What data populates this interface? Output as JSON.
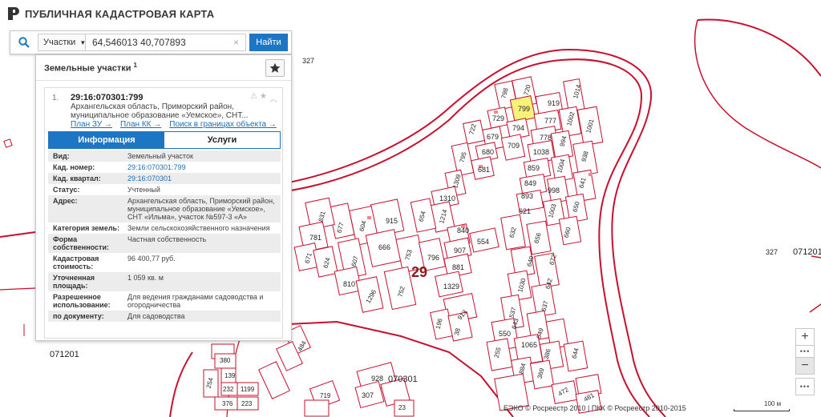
{
  "app": {
    "title": "ПУБЛИЧНАЯ КАДАСТРОВАЯ КАРТА"
  },
  "search": {
    "type_label": "Участки",
    "query": "64,546013 40,707893",
    "button_label": "Найти"
  },
  "panel": {
    "title": "Земельные участки",
    "count": "1",
    "item": {
      "number": "1.",
      "id": "29:16:070301:799",
      "address": "Архангельская область, Приморский район, муниципальное образование «Уемское», СНТ...",
      "links": [
        "План ЗУ →",
        "План КК →",
        "Поиск в границах объекта →"
      ]
    },
    "tabs": {
      "info": "Информация",
      "services": "Услуги"
    },
    "fields": [
      {
        "label": "Вид:",
        "value": "Земельный участок"
      },
      {
        "label": "Кад. номер:",
        "value": "29:16:070301:799",
        "link": true
      },
      {
        "label": "Кад. квартал:",
        "value": "29:16:070301",
        "link": true
      },
      {
        "label": "Статус:",
        "value": "Учтенный"
      },
      {
        "label": "Адрес:",
        "value": "Архангельская область, Приморский район, муниципальное образование «Уемское», СНТ «Ильма», участок №597-3 «А»"
      },
      {
        "label": "Категория земель:",
        "value": "Земли сельскохозяйственного назначения"
      },
      {
        "label": "Форма собственности:",
        "value": "Частная собственность"
      },
      {
        "label": "Кадастровая стоимость:",
        "value": "96 400,77 руб."
      },
      {
        "label": "Уточненная площадь:",
        "value": "1 059 кв. м"
      },
      {
        "label": "Разрешенное использование:",
        "value": "Для ведения гражданами садоводства и огородничества"
      },
      {
        "label": "по документу:",
        "value": "Для садоводства"
      }
    ]
  },
  "map": {
    "quarter_labels": [
      "327",
      "327",
      "071201",
      "071201",
      "070301"
    ],
    "block_label": "29",
    "selected_parcel": "799",
    "parcels": [
      "798",
      "720",
      "1014",
      "919",
      "777",
      "1002",
      "1001",
      "729",
      "794",
      "778",
      "994",
      "722",
      "679",
      "709",
      "1038",
      "938",
      "680",
      "795",
      "681",
      "859",
      "1004",
      "641",
      "1309",
      "849",
      "998",
      "1310",
      "893",
      "650",
      "621",
      "1003",
      "915",
      "654",
      "1214",
      "831",
      "604",
      "677",
      "840",
      "554",
      "632",
      "656",
      "660",
      "781",
      "666",
      "753",
      "907",
      "640",
      "624",
      "671",
      "607",
      "796",
      "881",
      "672",
      "810",
      "642",
      "1296",
      "752",
      "1329",
      "1030",
      "637",
      "537",
      "913",
      "643",
      "649",
      "196",
      "38",
      "550",
      "255",
      "1065",
      "386",
      "644",
      "884",
      "369",
      "484",
      "380",
      "139",
      "472",
      "254",
      "232",
      "1199",
      "481",
      "928",
      "307",
      "719",
      "376",
      "223",
      "23"
    ],
    "copyright": "ЕЭКО © Росреестр 2010 | ПКК © Росреестр 2010-2015",
    "scale_label": "100 м"
  },
  "controls": {
    "zoom_in": "+",
    "zoom_out": "−",
    "more": "•••"
  }
}
